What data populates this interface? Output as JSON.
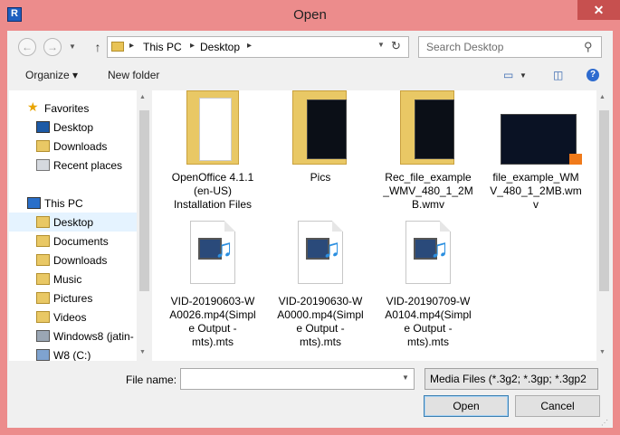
{
  "window": {
    "title": "Open",
    "app_icon_letter": "R",
    "close_glyph": "✕"
  },
  "address_bar": {
    "crumbs": [
      "This PC",
      "Desktop"
    ]
  },
  "search": {
    "placeholder": "Search Desktop"
  },
  "toolbar": {
    "organize": "Organize ▾",
    "new_folder": "New folder"
  },
  "nav": {
    "favorites_label": "Favorites",
    "favorites": [
      "Desktop",
      "Downloads",
      "Recent places"
    ],
    "thispc_label": "This PC",
    "thispc": [
      "Desktop",
      "Documents",
      "Downloads",
      "Music",
      "Pictures",
      "Videos",
      "Windows8 (jatin-",
      "W8 (C:)"
    ],
    "selected": "Desktop"
  },
  "files": [
    {
      "name_lines": [
        "OpenOffice 4.1.1",
        "(en-US)",
        "Installation Files"
      ],
      "kind": "folder-doc"
    },
    {
      "name_lines": [
        "Pics"
      ],
      "kind": "folder-photo"
    },
    {
      "name_lines": [
        "Rec_file_example",
        "_WMV_480_1_2M",
        "B.wmv"
      ],
      "kind": "folder-photo"
    },
    {
      "name_lines": [
        "file_example_WM",
        "V_480_1_2MB.wm",
        "v"
      ],
      "kind": "video"
    },
    {
      "name_lines": [
        "VID-20190603-W",
        "A0026.mp4(Simpl",
        "e Output -",
        "mts).mts"
      ],
      "kind": "media"
    },
    {
      "name_lines": [
        "VID-20190630-W",
        "A0000.mp4(Simpl",
        "e Output -",
        "mts).mts"
      ],
      "kind": "media"
    },
    {
      "name_lines": [
        "VID-20190709-W",
        "A0104.mp4(Simpl",
        "e Output -",
        "mts).mts"
      ],
      "kind": "media"
    }
  ],
  "filename": {
    "label": "File name:",
    "value": ""
  },
  "filter": {
    "value": "Media Files (*.3g2; *.3gp; *.3gp2"
  },
  "buttons": {
    "open": "Open",
    "cancel": "Cancel"
  }
}
